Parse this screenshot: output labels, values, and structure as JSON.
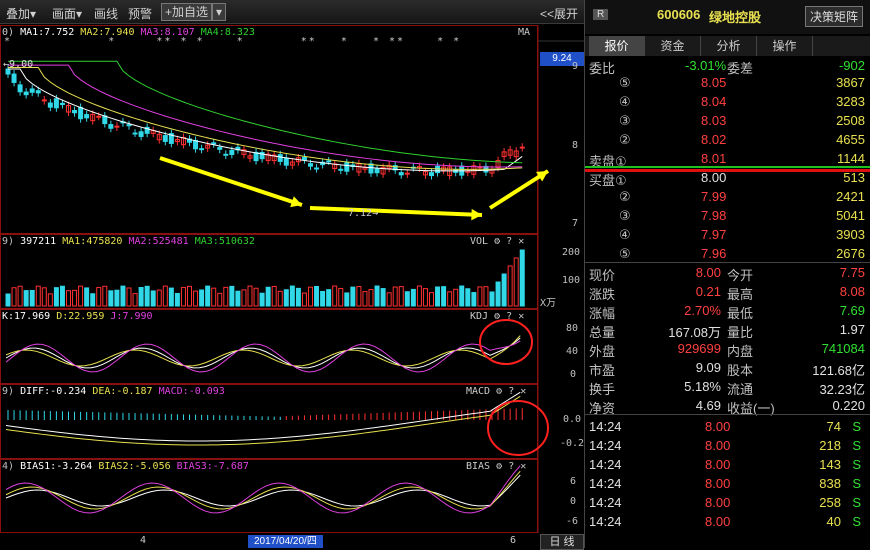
{
  "toolbar": {
    "overlay": "叠加▾",
    "draw": "画面▾",
    "lines": "画线",
    "alert": "预警",
    "add_fav": "+加自选",
    "expand": "<<展开"
  },
  "main_panel": {
    "title_prefix": "0)",
    "ma1": "MA1:7.752",
    "ma2": "MA2:7.940",
    "ma3": "MA3:8.107",
    "ma4": "MA4:8.323",
    "label": "MA",
    "price_tag": "9.24",
    "y_ticks": [
      "9",
      "8",
      "7"
    ],
    "high_marker": "9.00",
    "low_marker": "7.12"
  },
  "vol_panel": {
    "title_prefix": "9)",
    "vol": "397211",
    "ma1": "MA1:475820",
    "ma2": "MA2:525481",
    "ma3": "MA3:510632",
    "label": "VOL",
    "y_ticks": [
      "200",
      "100"
    ],
    "unit": "X万"
  },
  "kdj_panel": {
    "k": "K:17.969",
    "d": "D:22.959",
    "j": "J:7.990",
    "label": "KDJ",
    "y_ticks": [
      "80",
      "40",
      "0"
    ]
  },
  "macd_panel": {
    "title_prefix": "9)",
    "diff": "DIFF:-0.234",
    "dea": "DEA:-0.187",
    "macd": "MACD:-0.093",
    "label": "MACD",
    "y_ticks": [
      "0.0",
      "-0.2"
    ]
  },
  "bias_panel": {
    "title_prefix": "4)",
    "b1": "BIAS1:-3.264",
    "b2": "BIAS2:-5.056",
    "b3": "BIAS3:-7.687",
    "label": "BIAS",
    "y_ticks": [
      "6",
      "0",
      "-6"
    ]
  },
  "xaxis": {
    "left": "4",
    "date": "2017/04/20/四",
    "right": "6",
    "period": "日 线"
  },
  "colors": {
    "up": "#ff3030",
    "down": "#30d8e8",
    "ma1": "#ffffff",
    "ma2": "#e8e050",
    "ma3": "#e040e0",
    "ma4": "#30d030"
  },
  "stock": {
    "badge": "R",
    "code": "600606",
    "name": "绿地控股",
    "button": "决策矩阵"
  },
  "tabs": [
    "报价",
    "资金",
    "分析",
    "操作"
  ],
  "ratio": {
    "label1": "委比",
    "v1": "-3.01%",
    "label2": "委差",
    "v2": "-902"
  },
  "asks": [
    {
      "l": "⑤",
      "p": "8.05",
      "v": "3867"
    },
    {
      "l": "④",
      "p": "8.04",
      "v": "3283"
    },
    {
      "l": "③",
      "p": "8.03",
      "v": "2508"
    },
    {
      "l": "②",
      "p": "8.02",
      "v": "4655"
    },
    {
      "l": "卖盘①",
      "p": "8.01",
      "v": "1144"
    }
  ],
  "bids": [
    {
      "l": "买盘①",
      "p": "8.00",
      "v": "513"
    },
    {
      "l": "②",
      "p": "7.99",
      "v": "2421"
    },
    {
      "l": "③",
      "p": "7.98",
      "v": "5041"
    },
    {
      "l": "④",
      "p": "7.97",
      "v": "3903"
    },
    {
      "l": "⑤",
      "p": "7.96",
      "v": "2676"
    }
  ],
  "quote": [
    {
      "l1": "现价",
      "v1": "8.00",
      "l2": "今开",
      "v2": "7.75"
    },
    {
      "l1": "涨跌",
      "v1": "0.21",
      "l2": "最高",
      "v2": "8.08"
    },
    {
      "l1": "涨幅",
      "v1": "2.70%",
      "l2": "最低",
      "v2": "7.69"
    },
    {
      "l1": "总量",
      "v1": "167.08万",
      "l2": "量比",
      "v2": "1.97"
    },
    {
      "l1": "外盘",
      "v1": "929699",
      "l2": "内盘",
      "v2": "741084"
    },
    {
      "l1": "市盈",
      "v1": "9.09",
      "l2": "股本",
      "v2": "121.68亿"
    },
    {
      "l1": "换手",
      "v1": "5.18%",
      "l2": "流通",
      "v2": "32.23亿"
    },
    {
      "l1": "净资",
      "v1": "4.69",
      "l2": "收益(一)",
      "v2": "0.220"
    }
  ],
  "ticks": [
    {
      "t": "14:24",
      "p": "8.00",
      "v": "74",
      "s": "S"
    },
    {
      "t": "14:24",
      "p": "8.00",
      "v": "218",
      "s": "S"
    },
    {
      "t": "14:24",
      "p": "8.00",
      "v": "143",
      "s": "S"
    },
    {
      "t": "14:24",
      "p": "8.00",
      "v": "838",
      "s": "S"
    },
    {
      "t": "14:24",
      "p": "8.00",
      "v": "258",
      "s": "S"
    },
    {
      "t": "14:24",
      "p": "8.00",
      "v": "40",
      "s": "S"
    }
  ]
}
